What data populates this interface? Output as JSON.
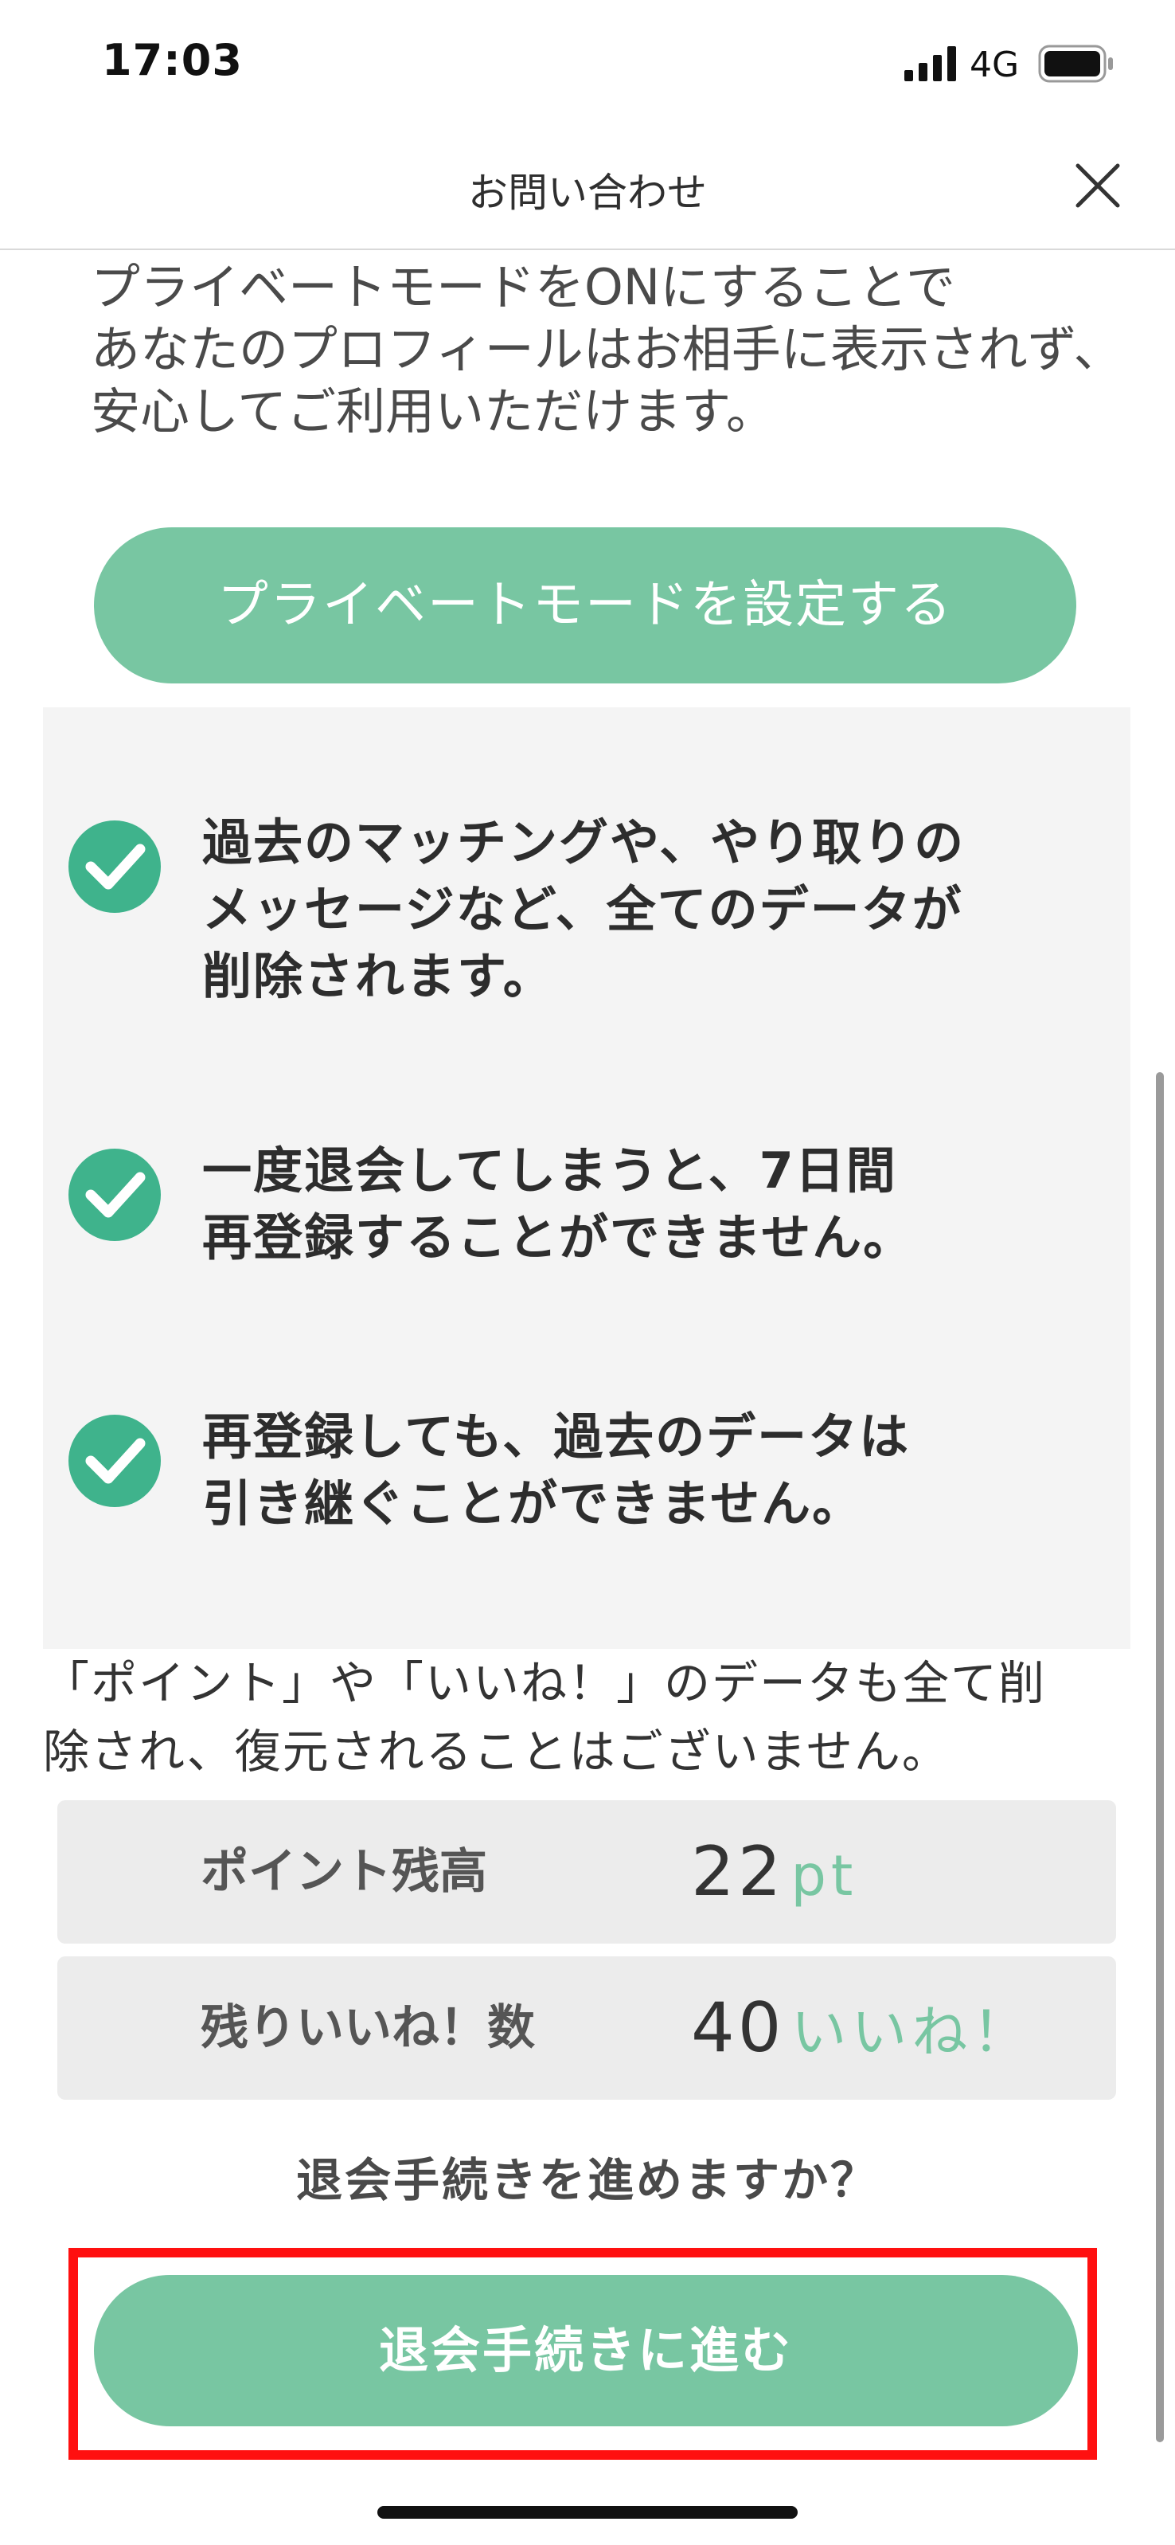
{
  "status_bar": {
    "time": "17:03",
    "network": "4G"
  },
  "nav": {
    "title": "お問い合わせ"
  },
  "intro": {
    "text": "プライベートモードをONにすることで\nあなたのプロフィールはお相手に表示されず、\n安心してご利用いただけます。"
  },
  "private_mode_button": {
    "label": "プライベートモードを設定する"
  },
  "notices": [
    {
      "text": "過去のマッチングや、やり取りの\nメッセージなど、全てのデータが\n削除されます。"
    },
    {
      "text": "一度退会してしまうと、7日間\n再登録することができません。"
    },
    {
      "text": "再登録しても、過去のデータは\n引き継ぐことができません。"
    }
  ],
  "warning": {
    "text": "「ポイント」や「いいね！」のデータも全て削\n除され、復元されることはございません。"
  },
  "balances": {
    "points": {
      "label": "ポイント残高",
      "value": "22",
      "unit": "pt"
    },
    "likes": {
      "label": "残りいいね！数",
      "value": "40",
      "unit": "いいね！"
    }
  },
  "confirm": {
    "question": "退会手続きを進めますか？",
    "button_label": "退会手続きに進む"
  },
  "colors": {
    "accent": "#78c6a2",
    "check": "#3fb38c",
    "highlight": "#ff1010",
    "panel": "#f4f4f4"
  },
  "icons": {
    "signal": "signal-icon",
    "battery": "battery-icon",
    "close": "close-icon",
    "check": "check-circle-icon"
  }
}
